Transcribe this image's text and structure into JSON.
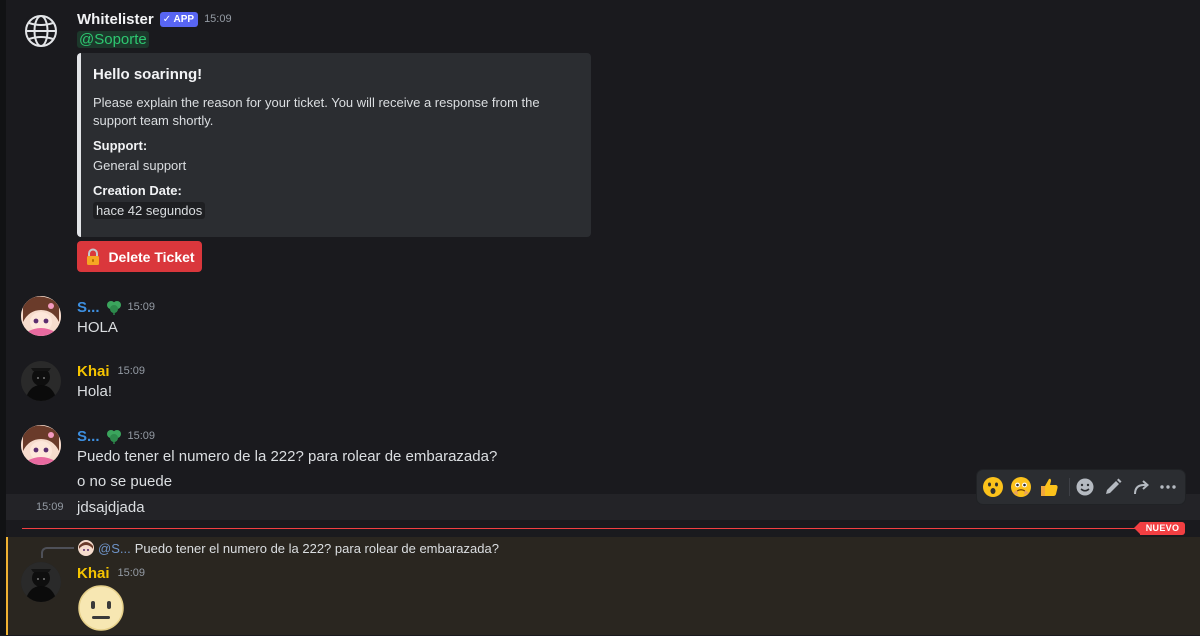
{
  "messages": [
    {
      "author": "Whitelister",
      "badge": "APP",
      "time": "15:09",
      "mention": "@Soporte",
      "embed": {
        "title": "Hello soarinng!",
        "description": "Please explain the reason for your ticket. You will receive a response from the support team shortly.",
        "fields": [
          {
            "name": "Support:",
            "value": "General support"
          },
          {
            "name": "Creation Date:",
            "value": "hace 42 segundos"
          }
        ]
      },
      "button_label": "Delete Ticket",
      "button_icon": "lock-icon"
    },
    {
      "author": "S...",
      "author_icon": "clover-icon",
      "time": "15:09",
      "lines": [
        "HOLA"
      ]
    },
    {
      "author": "Khai",
      "time": "15:09",
      "lines": [
        "Hola!"
      ]
    },
    {
      "author": "S...",
      "author_icon": "clover-icon",
      "time": "15:09",
      "lines": [
        "Puedo tener el numero de la 222? para rolear de embarazada?",
        "o no se puede"
      ]
    },
    {
      "time": "15:09",
      "lines": [
        "jdsajdjada"
      ]
    }
  ],
  "new_divider": "NUEVO",
  "reply": {
    "mention": "@S...",
    "text": "Puedo tener el numero de la 222? para rolear de embarazada?",
    "author": "Khai",
    "time": "15:09",
    "content_icon": "neutral-face-emoji"
  },
  "toolbar": [
    "astonished-face-emoji",
    "face-holding-back-tears-emoji",
    "thumbs-up-emoji",
    "add-reaction-icon",
    "edit-icon",
    "forward-icon",
    "more-icon"
  ],
  "colors": {
    "background": "#1a1a1e",
    "username_blue": "#3d8fe0",
    "username_khai": "#f5c400",
    "mention_green": "#2dc770",
    "danger": "#da373c",
    "new_divider": "#f23f42",
    "highlight_bar": "#f0b232"
  }
}
